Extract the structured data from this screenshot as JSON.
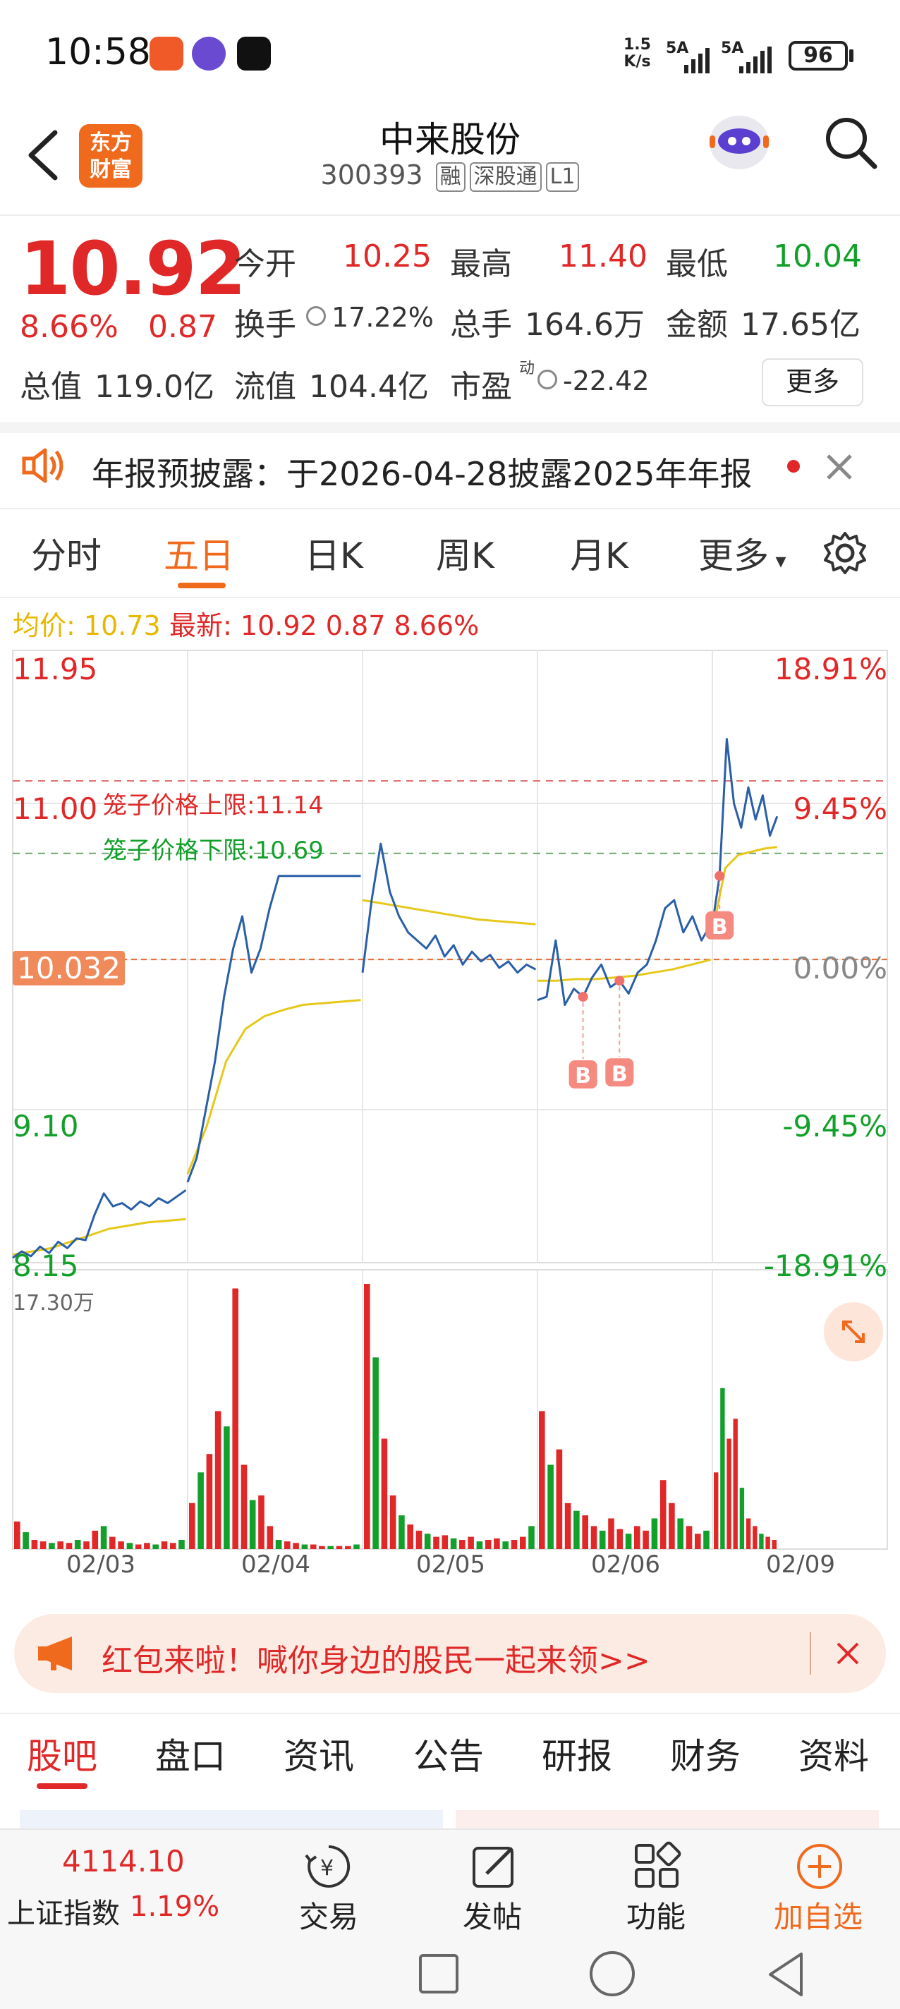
{
  "status_bar": {
    "time": "10:58",
    "net_speed_top": "1.5",
    "net_speed_bottom": "K/s",
    "sim1": "5A",
    "sim2": "5A",
    "battery": "96"
  },
  "header": {
    "logo_line1": "东方",
    "logo_line2": "财富",
    "stock_name": "中来股份",
    "stock_code": "300393",
    "tags": [
      "融",
      "深股通",
      "L1"
    ]
  },
  "quote": {
    "price": "10.92",
    "change_pct": "8.66%",
    "change_abs": "0.87",
    "rows": [
      [
        {
          "label": "今开",
          "value": "10.25",
          "color": "red"
        },
        {
          "label": "最高",
          "value": "11.40",
          "color": "red"
        },
        {
          "label": "最低",
          "value": "10.04",
          "color": "green"
        }
      ],
      [
        {
          "label": "换手",
          "value": "17.22%",
          "color": "dark"
        },
        {
          "label": "总手",
          "value": "164.6万",
          "color": "dark"
        },
        {
          "label": "金额",
          "value": "17.65亿",
          "color": "dark"
        }
      ],
      [
        {
          "label": "总值",
          "value": "119.0亿",
          "color": "dark"
        },
        {
          "label": "流值",
          "value": "104.4亿",
          "color": "dark"
        },
        {
          "label": "市盈",
          "value": "-22.42",
          "color": "dark"
        }
      ]
    ],
    "pe_superscript": "动",
    "more_button": "更多"
  },
  "announcement": {
    "text": "年报预披露：于2026-04-28披露2025年年报"
  },
  "chart_tabs": {
    "items": [
      "分时",
      "五日",
      "日K",
      "周K",
      "月K",
      "更多"
    ],
    "active_index": 1
  },
  "chart_header": {
    "avg_label": "均价:",
    "avg_value": "10.73",
    "latest_label": "最新:",
    "latest_value": "10.92",
    "latest_change": "0.87",
    "latest_pct": "8.66%"
  },
  "chart_data": {
    "type": "line",
    "y_left_ticks": [
      "11.95",
      "11.00",
      "10.032",
      "9.10",
      "8.15"
    ],
    "y_right_ticks": [
      "18.91%",
      "9.45%",
      "0.00%",
      "-9.45%",
      "-18.91%"
    ],
    "ylim": [
      8.15,
      11.95
    ],
    "x_labels": [
      "02/03",
      "02/04",
      "02/05",
      "02/06",
      "02/09"
    ],
    "pre_close": 10.032,
    "limit_upper_label": "笼子价格上限:11.14",
    "limit_upper": 11.14,
    "limit_lower_label": "笼子价格下限:10.69",
    "limit_lower": 10.69,
    "volume_max_label": "17.30万",
    "buy_marker": "B",
    "price_series": [
      {
        "day": "02/03",
        "points": [
          8.18,
          8.22,
          8.19,
          8.25,
          8.21,
          8.28,
          8.24,
          8.3,
          8.29,
          8.45,
          8.58,
          8.5,
          8.52,
          8.48,
          8.53,
          8.5,
          8.55,
          8.52,
          8.56,
          8.6
        ]
      },
      {
        "day": "02/04",
        "points": [
          8.65,
          8.8,
          9.1,
          9.4,
          9.8,
          10.1,
          10.3,
          9.95,
          10.1,
          10.35,
          10.55,
          10.55,
          10.55,
          10.55,
          10.55,
          10.55,
          10.55,
          10.55,
          10.55,
          10.55
        ]
      },
      {
        "day": "02/05",
        "points": [
          9.95,
          10.4,
          10.75,
          10.45,
          10.3,
          10.2,
          10.15,
          10.1,
          10.18,
          10.05,
          10.12,
          10.0,
          10.08,
          10.02,
          10.06,
          9.98,
          10.02,
          9.95,
          10.0,
          9.97
        ]
      },
      {
        "day": "02/06",
        "points": [
          9.78,
          9.8,
          10.15,
          9.75,
          9.85,
          9.8,
          9.92,
          10.0,
          9.86,
          9.9,
          9.82,
          9.95,
          10.0,
          10.15,
          10.35,
          10.4,
          10.2,
          10.3,
          10.15,
          10.25
        ]
      },
      {
        "day": "02/09",
        "points": [
          10.25,
          10.55,
          11.4,
          11.0,
          10.85,
          11.1,
          10.9,
          11.05,
          10.8,
          10.92
        ]
      }
    ],
    "avg_series": [
      {
        "day": "02/03",
        "points": [
          8.2,
          8.22,
          8.24,
          8.28,
          8.32,
          8.36,
          8.38,
          8.4,
          8.41,
          8.42
        ]
      },
      {
        "day": "02/04",
        "points": [
          8.7,
          9.0,
          9.4,
          9.6,
          9.68,
          9.72,
          9.75,
          9.76,
          9.77,
          9.78
        ]
      },
      {
        "day": "02/05",
        "points": [
          10.4,
          10.38,
          10.36,
          10.34,
          10.32,
          10.3,
          10.28,
          10.27,
          10.26,
          10.25
        ]
      },
      {
        "day": "02/06",
        "points": [
          9.9,
          9.9,
          9.91,
          9.91,
          9.92,
          9.93,
          9.95,
          9.97,
          10.0,
          10.03
        ]
      },
      {
        "day": "02/09",
        "points": [
          10.2,
          10.6,
          10.68,
          10.7,
          10.72,
          10.73
        ]
      }
    ],
    "volume_series": [
      {
        "day": "02/03",
        "values": [
          1.8,
          1.1,
          0.6,
          0.5,
          0.4,
          0.5,
          0.4,
          0.6,
          0.5,
          1.2,
          1.5,
          0.8,
          0.5,
          0.4,
          0.3,
          0.4,
          0.3,
          0.5,
          0.4,
          0.6
        ]
      },
      {
        "day": "02/04",
        "values": [
          3.0,
          5.0,
          6.2,
          9.0,
          8.0,
          17.0,
          5.5,
          3.2,
          3.5,
          1.5,
          0.6,
          0.5,
          0.4,
          0.3,
          0.3,
          0.2,
          0.2,
          0.2,
          0.2,
          0.3
        ]
      },
      {
        "day": "02/05",
        "values": [
          17.3,
          12.5,
          7.2,
          3.5,
          2.2,
          1.6,
          1.2,
          1.0,
          0.8,
          0.9,
          0.7,
          0.6,
          0.8,
          0.5,
          0.6,
          0.7,
          0.5,
          0.6,
          0.8,
          1.5
        ]
      },
      {
        "day": "02/06",
        "values": [
          9.0,
          5.5,
          6.5,
          3.0,
          2.5,
          2.2,
          1.5,
          1.2,
          2.0,
          1.3,
          1.0,
          1.5,
          1.2,
          2.0,
          4.5,
          3.0,
          2.0,
          1.5,
          1.0,
          1.2
        ]
      },
      {
        "day": "02/09",
        "values": [
          5.0,
          10.5,
          7.2,
          8.5,
          4.0,
          2.0,
          1.5,
          1.0,
          0.8,
          0.6
        ]
      }
    ]
  },
  "banner": {
    "text": "红包来啦！喊你身边的股民一起来领>>"
  },
  "bottom_tabs": [
    "股吧",
    "盘口",
    "资讯",
    "公告",
    "研报",
    "财务",
    "资料"
  ],
  "bottom_nav": {
    "index_value": "4114.10",
    "index_name": "上证指数",
    "index_pct": "1.19%",
    "items": [
      {
        "label": "交易",
        "icon": "trade-icon"
      },
      {
        "label": "发帖",
        "icon": "post-icon"
      },
      {
        "label": "功能",
        "icon": "grid-icon"
      },
      {
        "label": "加自选",
        "icon": "add-icon"
      }
    ]
  },
  "colors": {
    "up": "#e02828",
    "down": "#12a02a",
    "accent": "#f06a1e",
    "price_line": "#2a5fa8",
    "avg_line": "#e6c81a"
  }
}
